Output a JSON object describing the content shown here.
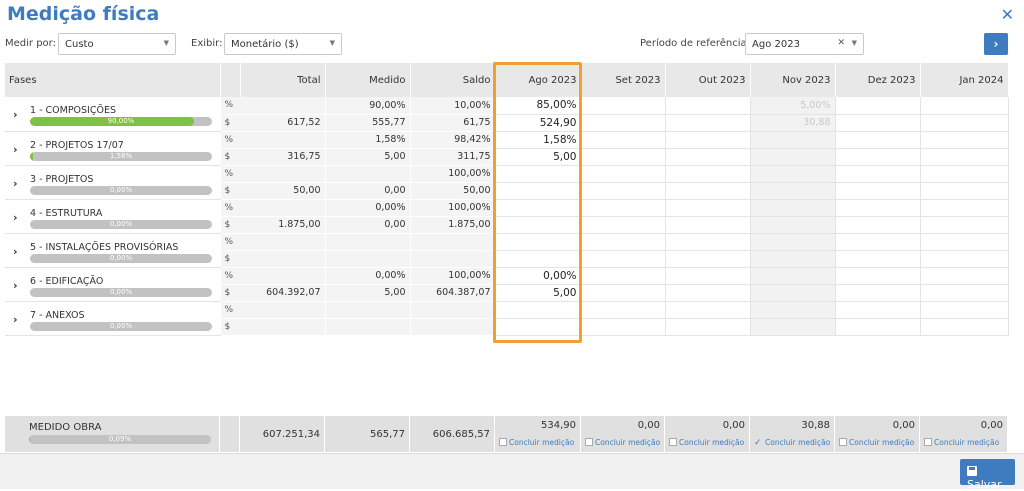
{
  "title": "Medição física",
  "controls": {
    "medir_label": "Medir por:",
    "medir_value": "Custo",
    "exibir_label": "Exibir:",
    "exibir_value": "Monetário ($)",
    "periodo_label": "Período de referência:",
    "periodo_value": "Ago 2023"
  },
  "headers": {
    "fases": "Fases",
    "total": "Total",
    "medido": "Medido",
    "saldo": "Saldo",
    "months": [
      "Ago 2023",
      "Set 2023",
      "Out 2023",
      "Nov 2023",
      "Dez 2023",
      "Jan 2024"
    ]
  },
  "phases": [
    {
      "name": "1 - COMPOSIÇÕES",
      "progress": "90,00%",
      "fill": 90,
      "pct": {
        "unit": "%",
        "total": "",
        "medido": "90,00%",
        "saldo": "10,00%",
        "cur": "85,00%",
        "nov": "5,00%"
      },
      "money": {
        "unit": "$",
        "total": "617,52",
        "medido": "555,77",
        "saldo": "61,75",
        "cur": "524,90",
        "nov": "30,88"
      }
    },
    {
      "name": "2 - PROJETOS 17/07",
      "progress": "1,58%",
      "fill": 1.58,
      "pct": {
        "unit": "%",
        "total": "",
        "medido": "1,58%",
        "saldo": "98,42%",
        "cur": "1,58%",
        "nov": ""
      },
      "money": {
        "unit": "$",
        "total": "316,75",
        "medido": "5,00",
        "saldo": "311,75",
        "cur": "5,00",
        "nov": ""
      }
    },
    {
      "name": "3 - PROJETOS",
      "progress": "0,00%",
      "fill": 0,
      "pct": {
        "unit": "%",
        "total": "",
        "medido": "",
        "saldo": "100,00%",
        "cur": "",
        "nov": ""
      },
      "money": {
        "unit": "$",
        "total": "50,00",
        "medido": "0,00",
        "saldo": "50,00",
        "cur": "",
        "nov": ""
      }
    },
    {
      "name": "4 - ESTRUTURA",
      "progress": "0,00%",
      "fill": 0,
      "pct": {
        "unit": "%",
        "total": "",
        "medido": "0,00%",
        "saldo": "100,00%",
        "cur": "",
        "nov": ""
      },
      "money": {
        "unit": "$",
        "total": "1.875,00",
        "medido": "0,00",
        "saldo": "1.875,00",
        "cur": "",
        "nov": ""
      }
    },
    {
      "name": "5 - INSTALAÇÕES PROVISÓRIAS",
      "progress": "0,00%",
      "fill": 0,
      "pct": {
        "unit": "%",
        "total": "",
        "medido": "",
        "saldo": "",
        "cur": "",
        "nov": ""
      },
      "money": {
        "unit": "$",
        "total": "",
        "medido": "",
        "saldo": "",
        "cur": "",
        "nov": ""
      }
    },
    {
      "name": "6 - EDIFICAÇÃO",
      "progress": "0,00%",
      "fill": 0,
      "pct": {
        "unit": "%",
        "total": "",
        "medido": "0,00%",
        "saldo": "100,00%",
        "cur": "0,00%",
        "nov": ""
      },
      "money": {
        "unit": "$",
        "total": "604.392,07",
        "medido": "5,00",
        "saldo": "604.387,07",
        "cur": "5,00",
        "nov": ""
      }
    },
    {
      "name": "7 - ANEXOS",
      "progress": "0,00%",
      "fill": 0,
      "pct": {
        "unit": "%",
        "total": "",
        "medido": "",
        "saldo": "",
        "cur": "",
        "nov": ""
      },
      "money": {
        "unit": "$",
        "total": "",
        "medido": "",
        "saldo": "",
        "cur": "",
        "nov": ""
      }
    }
  ],
  "totals": {
    "label": "MEDIDO OBRA",
    "progress": "0,09%",
    "fill": 0.09,
    "total": "607.251,34",
    "medido": "565,77",
    "saldo": "606.685,57",
    "months": [
      {
        "value": "534,90",
        "checked": false
      },
      {
        "value": "0,00",
        "checked": false
      },
      {
        "value": "0,00",
        "checked": false
      },
      {
        "value": "30,88",
        "checked": true
      },
      {
        "value": "0,00",
        "checked": false
      },
      {
        "value": "0,00",
        "checked": false
      }
    ],
    "concluir_label": "Concluir medição"
  },
  "save_label": "Salvar",
  "colors": {
    "accent": "#3e7cbf",
    "progress": "#7fc142",
    "highlight": "#f0a030"
  }
}
